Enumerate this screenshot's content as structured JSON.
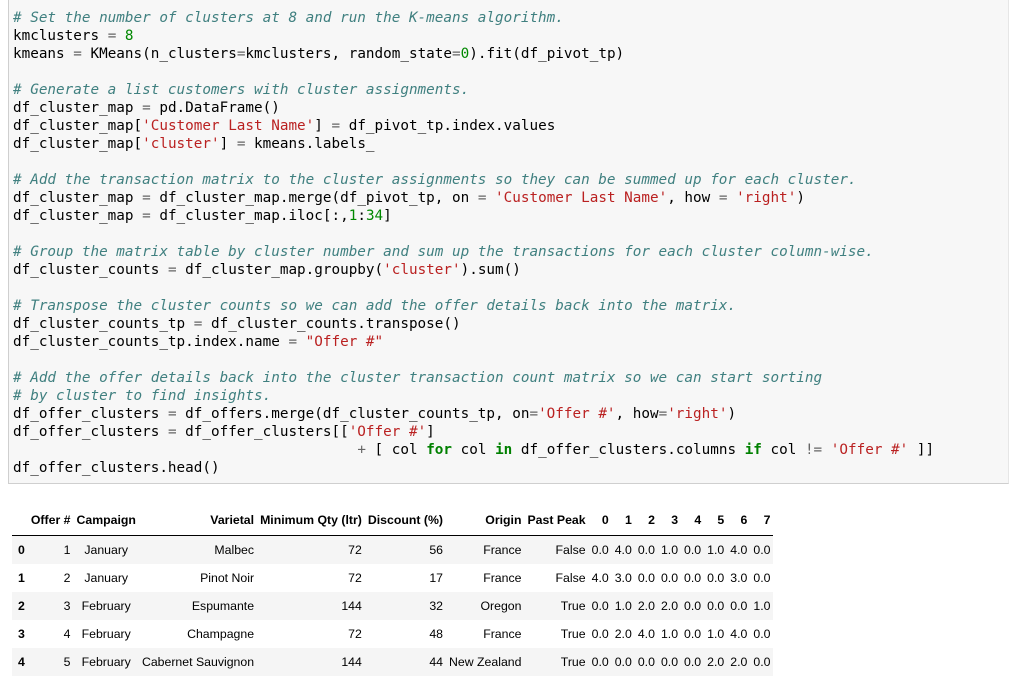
{
  "code_lines": [
    [
      {
        "t": "c",
        "v": "# Set the number of clusters at 8 and run the K-means algorithm."
      }
    ],
    [
      {
        "t": "p",
        "v": "kmclusters "
      },
      {
        "t": "o",
        "v": "="
      },
      {
        "t": "p",
        "v": " "
      },
      {
        "t": "n",
        "v": "8"
      }
    ],
    [
      {
        "t": "p",
        "v": "kmeans "
      },
      {
        "t": "o",
        "v": "="
      },
      {
        "t": "p",
        "v": " KMeans(n_clusters"
      },
      {
        "t": "o",
        "v": "="
      },
      {
        "t": "p",
        "v": "kmclusters, random_state"
      },
      {
        "t": "o",
        "v": "="
      },
      {
        "t": "n",
        "v": "0"
      },
      {
        "t": "p",
        "v": ").fit(df_pivot_tp)"
      }
    ],
    [],
    [
      {
        "t": "c",
        "v": "# Generate a list customers with cluster assignments."
      }
    ],
    [
      {
        "t": "p",
        "v": "df_cluster_map "
      },
      {
        "t": "o",
        "v": "="
      },
      {
        "t": "p",
        "v": " pd.DataFrame()"
      }
    ],
    [
      {
        "t": "p",
        "v": "df_cluster_map["
      },
      {
        "t": "s",
        "v": "'Customer Last Name'"
      },
      {
        "t": "p",
        "v": "] "
      },
      {
        "t": "o",
        "v": "="
      },
      {
        "t": "p",
        "v": " df_pivot_tp.index.values"
      }
    ],
    [
      {
        "t": "p",
        "v": "df_cluster_map["
      },
      {
        "t": "s",
        "v": "'cluster'"
      },
      {
        "t": "p",
        "v": "] "
      },
      {
        "t": "o",
        "v": "="
      },
      {
        "t": "p",
        "v": " kmeans.labels_"
      }
    ],
    [],
    [
      {
        "t": "c",
        "v": "# Add the transaction matrix to the cluster assignments so they can be summed up for each cluster."
      }
    ],
    [
      {
        "t": "p",
        "v": "df_cluster_map "
      },
      {
        "t": "o",
        "v": "="
      },
      {
        "t": "p",
        "v": " df_cluster_map.merge(df_pivot_tp, on "
      },
      {
        "t": "o",
        "v": "="
      },
      {
        "t": "p",
        "v": " "
      },
      {
        "t": "s",
        "v": "'Customer Last Name'"
      },
      {
        "t": "p",
        "v": ", how "
      },
      {
        "t": "o",
        "v": "="
      },
      {
        "t": "p",
        "v": " "
      },
      {
        "t": "s",
        "v": "'right'"
      },
      {
        "t": "p",
        "v": ")"
      }
    ],
    [
      {
        "t": "p",
        "v": "df_cluster_map "
      },
      {
        "t": "o",
        "v": "="
      },
      {
        "t": "p",
        "v": " df_cluster_map.iloc[:,"
      },
      {
        "t": "n",
        "v": "1"
      },
      {
        "t": "p",
        "v": ":"
      },
      {
        "t": "n",
        "v": "34"
      },
      {
        "t": "p",
        "v": "]"
      }
    ],
    [],
    [
      {
        "t": "c",
        "v": "# Group the matrix table by cluster number and sum up the transactions for each cluster column-wise."
      }
    ],
    [
      {
        "t": "p",
        "v": "df_cluster_counts "
      },
      {
        "t": "o",
        "v": "="
      },
      {
        "t": "p",
        "v": " df_cluster_map.groupby("
      },
      {
        "t": "s",
        "v": "'cluster'"
      },
      {
        "t": "p",
        "v": ").sum()"
      }
    ],
    [],
    [
      {
        "t": "c",
        "v": "# Transpose the cluster counts so we can add the offer details back into the matrix."
      }
    ],
    [
      {
        "t": "p",
        "v": "df_cluster_counts_tp "
      },
      {
        "t": "o",
        "v": "="
      },
      {
        "t": "p",
        "v": " df_cluster_counts.transpose()"
      }
    ],
    [
      {
        "t": "p",
        "v": "df_cluster_counts_tp.index.name "
      },
      {
        "t": "o",
        "v": "="
      },
      {
        "t": "p",
        "v": " "
      },
      {
        "t": "s",
        "v": "\"Offer #\""
      }
    ],
    [],
    [
      {
        "t": "c",
        "v": "# Add the offer details back into the cluster transaction count matrix so we can start sorting"
      }
    ],
    [
      {
        "t": "c",
        "v": "# by cluster to find insights."
      }
    ],
    [
      {
        "t": "p",
        "v": "df_offer_clusters "
      },
      {
        "t": "o",
        "v": "="
      },
      {
        "t": "p",
        "v": " df_offers.merge(df_cluster_counts_tp, on"
      },
      {
        "t": "o",
        "v": "="
      },
      {
        "t": "s",
        "v": "'Offer #'"
      },
      {
        "t": "p",
        "v": ", how"
      },
      {
        "t": "o",
        "v": "="
      },
      {
        "t": "s",
        "v": "'right'"
      },
      {
        "t": "p",
        "v": ")"
      }
    ],
    [
      {
        "t": "p",
        "v": "df_offer_clusters "
      },
      {
        "t": "o",
        "v": "="
      },
      {
        "t": "p",
        "v": " df_offer_clusters[["
      },
      {
        "t": "s",
        "v": "'Offer #'"
      },
      {
        "t": "p",
        "v": "]"
      }
    ],
    [
      {
        "t": "p",
        "v": "                                        "
      },
      {
        "t": "o",
        "v": "+"
      },
      {
        "t": "p",
        "v": " [ col "
      },
      {
        "t": "k",
        "v": "for"
      },
      {
        "t": "p",
        "v": " col "
      },
      {
        "t": "k",
        "v": "in"
      },
      {
        "t": "p",
        "v": " df_offer_clusters.columns "
      },
      {
        "t": "k",
        "v": "if"
      },
      {
        "t": "p",
        "v": " col "
      },
      {
        "t": "o",
        "v": "!="
      },
      {
        "t": "p",
        "v": " "
      },
      {
        "t": "s",
        "v": "'Offer #'"
      },
      {
        "t": "p",
        "v": " ]]"
      }
    ],
    [
      {
        "t": "p",
        "v": "df_offer_clusters.head()"
      }
    ]
  ],
  "table": {
    "columns": [
      "",
      "Offer #",
      "Campaign",
      "Varietal",
      "Minimum Qty (ltr)",
      "Discount (%)",
      "Origin",
      "Past Peak",
      "0",
      "1",
      "2",
      "3",
      "4",
      "5",
      "6",
      "7"
    ],
    "rows": [
      {
        "index": "0",
        "cells": [
          "1",
          "January",
          "Malbec",
          "72",
          "56",
          "France",
          "False",
          "0.0",
          "4.0",
          "0.0",
          "1.0",
          "0.0",
          "1.0",
          "4.0",
          "0.0"
        ]
      },
      {
        "index": "1",
        "cells": [
          "2",
          "January",
          "Pinot Noir",
          "72",
          "17",
          "France",
          "False",
          "4.0",
          "3.0",
          "0.0",
          "0.0",
          "0.0",
          "0.0",
          "3.0",
          "0.0"
        ]
      },
      {
        "index": "2",
        "cells": [
          "3",
          "February",
          "Espumante",
          "144",
          "32",
          "Oregon",
          "True",
          "0.0",
          "1.0",
          "2.0",
          "2.0",
          "0.0",
          "0.0",
          "0.0",
          "1.0"
        ]
      },
      {
        "index": "3",
        "cells": [
          "4",
          "February",
          "Champagne",
          "72",
          "48",
          "France",
          "True",
          "0.0",
          "2.0",
          "4.0",
          "1.0",
          "0.0",
          "1.0",
          "4.0",
          "0.0"
        ]
      },
      {
        "index": "4",
        "cells": [
          "5",
          "February",
          "Cabernet Sauvignon",
          "144",
          "44",
          "New Zealand",
          "True",
          "0.0",
          "0.0",
          "0.0",
          "0.0",
          "0.0",
          "2.0",
          "2.0",
          "0.0"
        ]
      }
    ]
  },
  "colors": {
    "comment": "#408080",
    "string": "#ba2121",
    "number": "#008800",
    "keyword": "#008000",
    "operator": "#666666",
    "cell_background": "#f7f7f7",
    "row_stripe": "#f5f5f5"
  }
}
